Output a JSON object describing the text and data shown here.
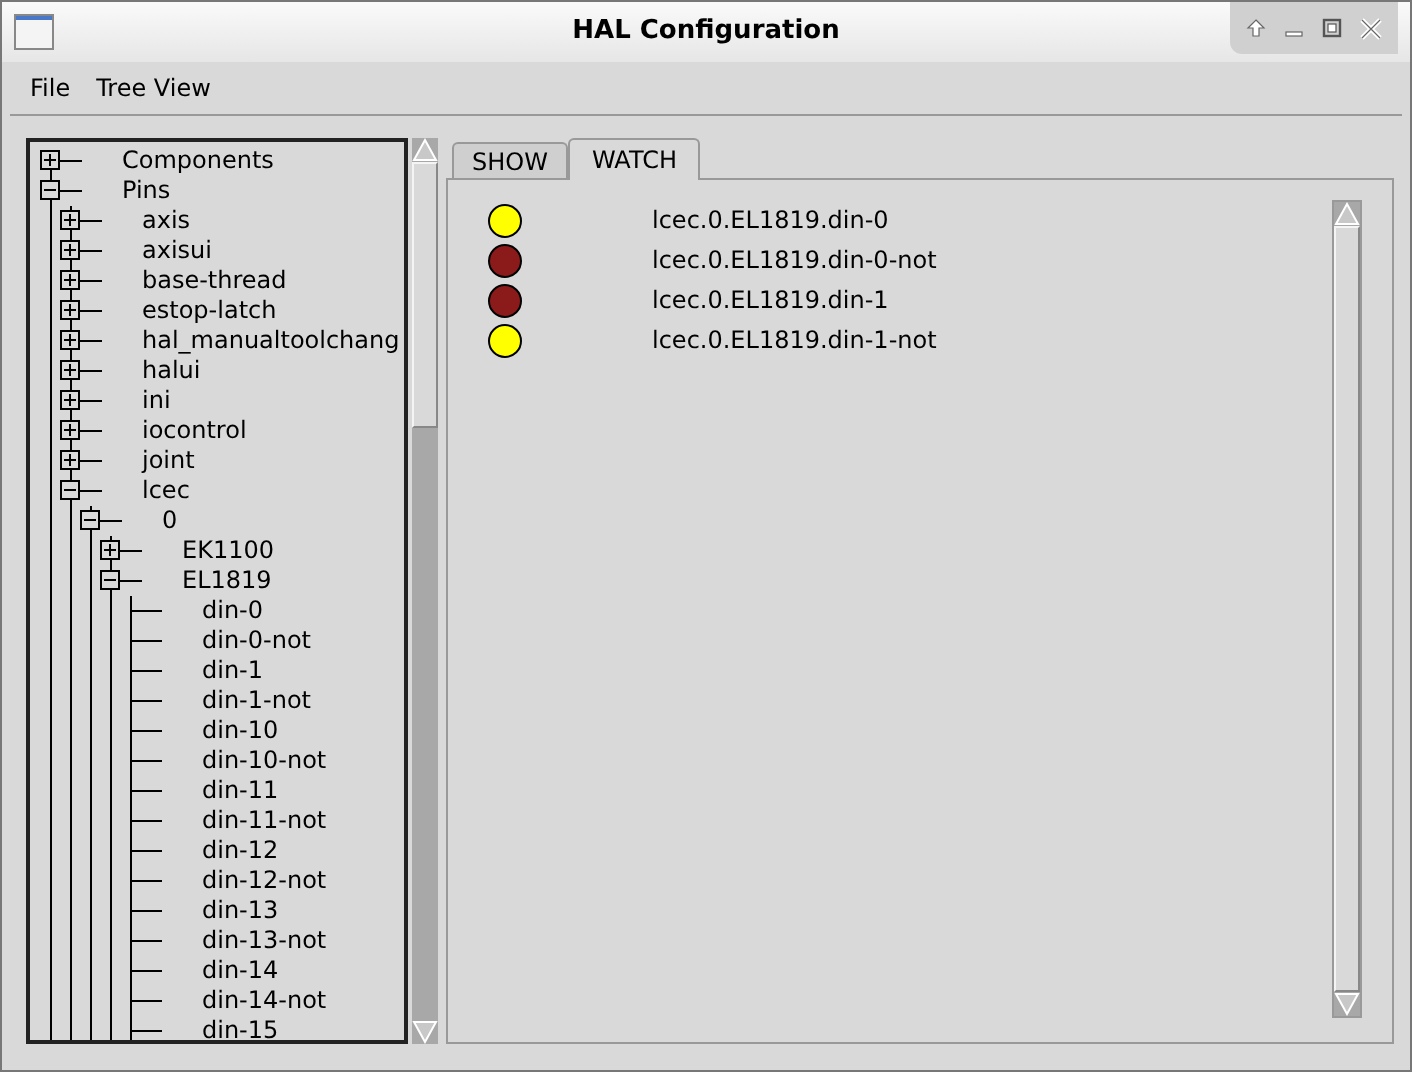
{
  "window": {
    "title": "HAL Configuration"
  },
  "menu": [
    "File",
    "Tree View"
  ],
  "tree": [
    {
      "label": "Components",
      "expanded": false
    },
    {
      "label": "Pins",
      "expanded": true,
      "children": [
        {
          "label": "axis",
          "expanded": false
        },
        {
          "label": "axisui",
          "expanded": false
        },
        {
          "label": "base-thread",
          "expanded": false
        },
        {
          "label": "estop-latch",
          "expanded": false
        },
        {
          "label": "hal_manualtoolchang",
          "expanded": false
        },
        {
          "label": "halui",
          "expanded": false
        },
        {
          "label": "ini",
          "expanded": false
        },
        {
          "label": "iocontrol",
          "expanded": false
        },
        {
          "label": "joint",
          "expanded": false
        },
        {
          "label": "lcec",
          "expanded": true,
          "children": [
            {
              "label": "0",
              "expanded": true,
              "children": [
                {
                  "label": "EK1100",
                  "expanded": false
                },
                {
                  "label": "EL1819",
                  "expanded": true,
                  "children": [
                    {
                      "label": "din-0"
                    },
                    {
                      "label": "din-0-not"
                    },
                    {
                      "label": "din-1"
                    },
                    {
                      "label": "din-1-not"
                    },
                    {
                      "label": "din-10"
                    },
                    {
                      "label": "din-10-not"
                    },
                    {
                      "label": "din-11"
                    },
                    {
                      "label": "din-11-not"
                    },
                    {
                      "label": "din-12"
                    },
                    {
                      "label": "din-12-not"
                    },
                    {
                      "label": "din-13"
                    },
                    {
                      "label": "din-13-not"
                    },
                    {
                      "label": "din-14"
                    },
                    {
                      "label": "din-14-not"
                    },
                    {
                      "label": "din-15"
                    }
                  ]
                }
              ]
            }
          ]
        }
      ]
    }
  ],
  "tabs": [
    {
      "label": "SHOW",
      "selected": false
    },
    {
      "label": "WATCH",
      "selected": true
    }
  ],
  "watch": [
    {
      "pin": "lcec.0.EL1819.din-0",
      "on": true
    },
    {
      "pin": "lcec.0.EL1819.din-0-not",
      "on": false
    },
    {
      "pin": "lcec.0.EL1819.din-1",
      "on": false
    },
    {
      "pin": "lcec.0.EL1819.din-1-not",
      "on": true
    }
  ]
}
